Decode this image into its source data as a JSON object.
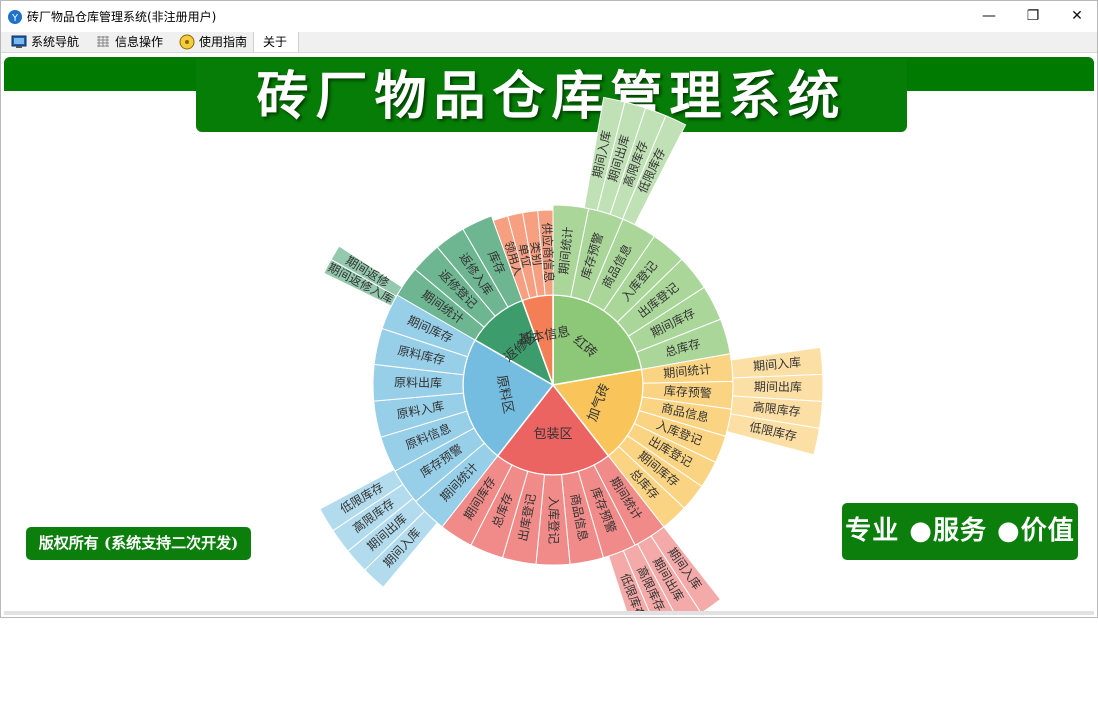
{
  "window": {
    "title": "砖厂物品仓库管理系统(非注册用户)",
    "controls": {
      "minimize": "—",
      "restore": "❐",
      "close": "✕"
    }
  },
  "menu": [
    {
      "label": "系统导航",
      "icon": "monitor-icon"
    },
    {
      "label": "信息操作",
      "icon": "grid-icon"
    },
    {
      "label": "使用指南",
      "icon": "compass-icon"
    },
    {
      "label": "关于",
      "icon": ""
    }
  ],
  "banner": {
    "title": "砖厂物品仓库管理系统"
  },
  "footer": {
    "copyright": "版权所有 (系统支持二次开发)",
    "slogan": "专业 ●服务 ●价值"
  },
  "colors": {
    "green_bar": "#007a00",
    "segments": {
      "hongzhuan": "#8dc878",
      "jiaqizhuan": "#f9c55a",
      "baozhuan": "#eb6462",
      "yuanliao": "#74bde0",
      "fanxiu": "#3d9c6c",
      "jiben": "#f47f57"
    }
  },
  "sunburst": {
    "inner": [
      {
        "label": "红砖",
        "key": "hongzhuan"
      },
      {
        "label": "加气砖",
        "key": "jiaqizhuan"
      },
      {
        "label": "包装区",
        "key": "baozhuan"
      },
      {
        "label": "原料区",
        "key": "yuanliao"
      },
      {
        "label": "返修区",
        "key": "fanxiu"
      },
      {
        "label": "基本信息",
        "key": "jiben"
      }
    ],
    "middle": {
      "hongzhuan": [
        "期间统计",
        "库存预警",
        "商品信息",
        "入库登记",
        "出库登记",
        "期间库存",
        "总库存"
      ],
      "jiaqizhuan": [
        "期间统计",
        "库存预警",
        "商品信息",
        "入库登记",
        "出库登记",
        "期间库存",
        "总库存"
      ],
      "baozhuan": [
        "期间统计",
        "库存预警",
        "商品信息",
        "入库登记",
        "出库登记",
        "总库存",
        "期间库存"
      ],
      "yuanliao": [
        "期间统计",
        "库存预警",
        "原料信息",
        "原料入库",
        "原料出库",
        "原料库存",
        "期间库存"
      ],
      "fanxiu": [
        "期间统计",
        "返修登记",
        "返修入库",
        "库存"
      ],
      "jiben": [
        "领用人",
        "单位",
        "类别",
        "供应商信息"
      ]
    },
    "outer": {
      "hongzhuan": [
        "期间入库",
        "期间出库",
        "高限库存",
        "低限库存"
      ],
      "jiaqizhuan": [
        "期间入库",
        "期间出库",
        "高限库存",
        "低限库存"
      ],
      "baozhuan": [
        "期间入库",
        "期间出库",
        "高限库存",
        "低限库存"
      ],
      "yuanliao": [
        "期间入库",
        "期间出库",
        "高限库存",
        "低限库存"
      ],
      "fanxiu": [
        "期间返修入库",
        "期间返修"
      ]
    }
  }
}
